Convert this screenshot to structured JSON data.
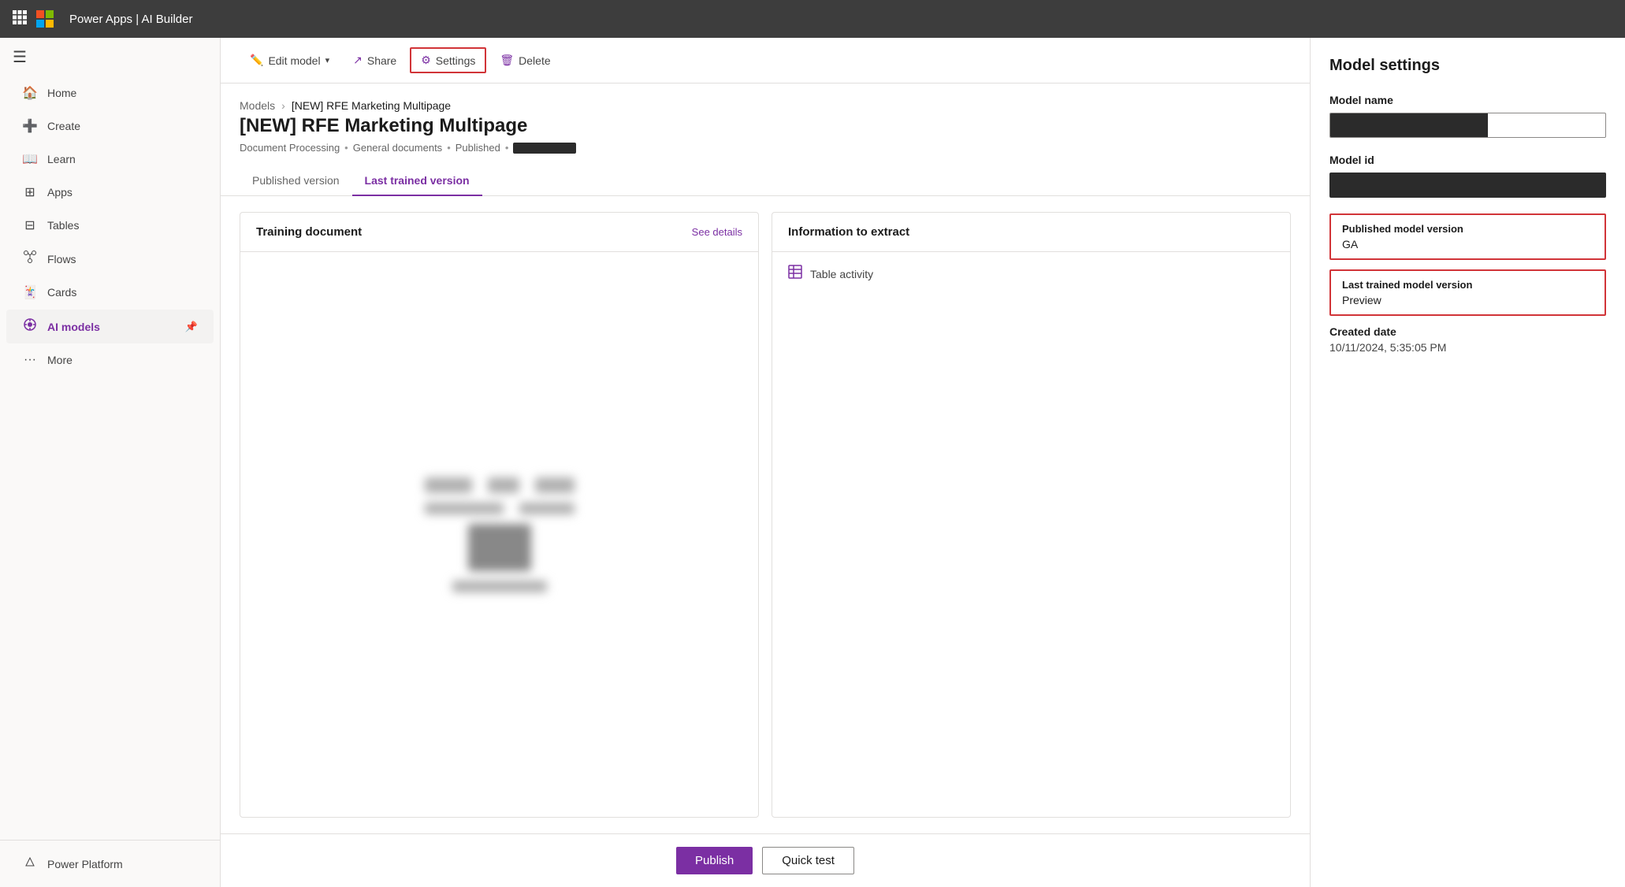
{
  "topbar": {
    "brand": "Power Apps | AI Builder",
    "grid_icon": "⊞"
  },
  "sidebar": {
    "toggle_icon": "☰",
    "items": [
      {
        "id": "home",
        "label": "Home",
        "icon": "⌂"
      },
      {
        "id": "create",
        "label": "Create",
        "icon": "+"
      },
      {
        "id": "learn",
        "label": "Learn",
        "icon": "□"
      },
      {
        "id": "apps",
        "label": "Apps",
        "icon": "▦"
      },
      {
        "id": "tables",
        "label": "Tables",
        "icon": "⊞"
      },
      {
        "id": "flows",
        "label": "Flows",
        "icon": "∞"
      },
      {
        "id": "cards",
        "label": "Cards",
        "icon": "▤"
      },
      {
        "id": "ai-models",
        "label": "AI models",
        "icon": "$",
        "active": true
      },
      {
        "id": "more",
        "label": "More",
        "icon": "···"
      }
    ],
    "bottom_items": [
      {
        "id": "power-platform",
        "label": "Power Platform",
        "icon": "🔌"
      }
    ]
  },
  "toolbar": {
    "edit_model_label": "Edit model",
    "share_label": "Share",
    "settings_label": "Settings",
    "delete_label": "Delete"
  },
  "page": {
    "breadcrumb_parent": "Models",
    "title": "[NEW] RFE Marketing Multipage",
    "meta_doc_type": "Document Processing",
    "meta_doc_subtype": "General documents",
    "meta_status": "Published"
  },
  "tabs": [
    {
      "id": "published",
      "label": "Published version"
    },
    {
      "id": "last-trained",
      "label": "Last trained version",
      "active": true
    }
  ],
  "training_card": {
    "title": "Training document",
    "link_label": "See details"
  },
  "info_card": {
    "title": "Information to extract",
    "items": [
      {
        "icon": "⊞",
        "label": "Table activity"
      }
    ]
  },
  "footer": {
    "publish_label": "Publish",
    "quick_test_label": "Quick test"
  },
  "settings_panel": {
    "title": "Model settings",
    "model_name_label": "Model name",
    "model_id_label": "Model id",
    "published_model_version_label": "Published model version",
    "published_model_version_value": "GA",
    "last_trained_model_version_label": "Last trained model version",
    "last_trained_model_version_value": "Preview",
    "created_date_label": "Created date",
    "created_date_value": "10/11/2024, 5:35:05 PM"
  }
}
